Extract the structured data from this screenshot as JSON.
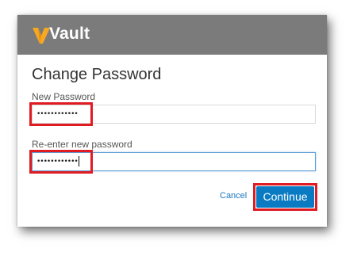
{
  "header": {
    "brand": "Vault",
    "brand_accent_color": "#f7a823",
    "background_color": "#7b7b7b"
  },
  "form": {
    "title": "Change Password",
    "new_password": {
      "label": "New Password",
      "masked_value": "••••••••••••"
    },
    "reenter_password": {
      "label": "Re-enter new password",
      "masked_value": "••••••••••••"
    }
  },
  "actions": {
    "cancel_label": "Cancel",
    "continue_label": "Continue",
    "primary_color": "#0a7bc2"
  },
  "annotation": {
    "highlight_color": "#e01b22"
  }
}
